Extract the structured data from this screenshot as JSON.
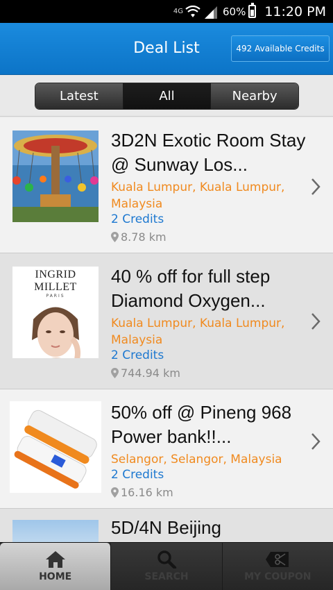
{
  "status_bar": {
    "network": "4G",
    "battery_percent": "60%",
    "battery_level": 0.6,
    "time": "11:20 PM"
  },
  "header": {
    "title": "Deal List",
    "credits_label": "492 Available Credits"
  },
  "tabs": [
    {
      "label": "Latest",
      "active": false
    },
    {
      "label": "All",
      "active": true
    },
    {
      "label": "Nearby",
      "active": false
    }
  ],
  "deals": [
    {
      "title": "3D2N Exotic Room Stay @ Sunway Los...",
      "location": "Kuala Lumpur, Kuala Lumpur, Malaysia",
      "credits": "2 Credits",
      "distance": "8.78 km"
    },
    {
      "title": "40 % off for full step Diamond Oxygen...",
      "location": "Kuala Lumpur, Kuala Lumpur, Malaysia",
      "credits": "2 Credits",
      "distance": "744.94 km",
      "brand_logo": "INGRID MILLET",
      "brand_sub": "PARIS"
    },
    {
      "title": "50% off @ Pineng 968 Power bank!!...",
      "location": "Selangor, Selangor, Malaysia",
      "credits": "2 Credits",
      "distance": "16.16 km"
    },
    {
      "title": "5D/4N Beijing"
    }
  ],
  "bottom_nav": [
    {
      "label": "HOME",
      "icon": "home-icon",
      "active": true
    },
    {
      "label": "SEARCH",
      "icon": "search-icon",
      "active": false
    },
    {
      "label": "MY COUPON",
      "icon": "coupon-icon",
      "active": false
    }
  ],
  "colors": {
    "header_blue": "#0c74c7",
    "location_orange": "#f08a1f",
    "credits_blue": "#1d78d0"
  }
}
